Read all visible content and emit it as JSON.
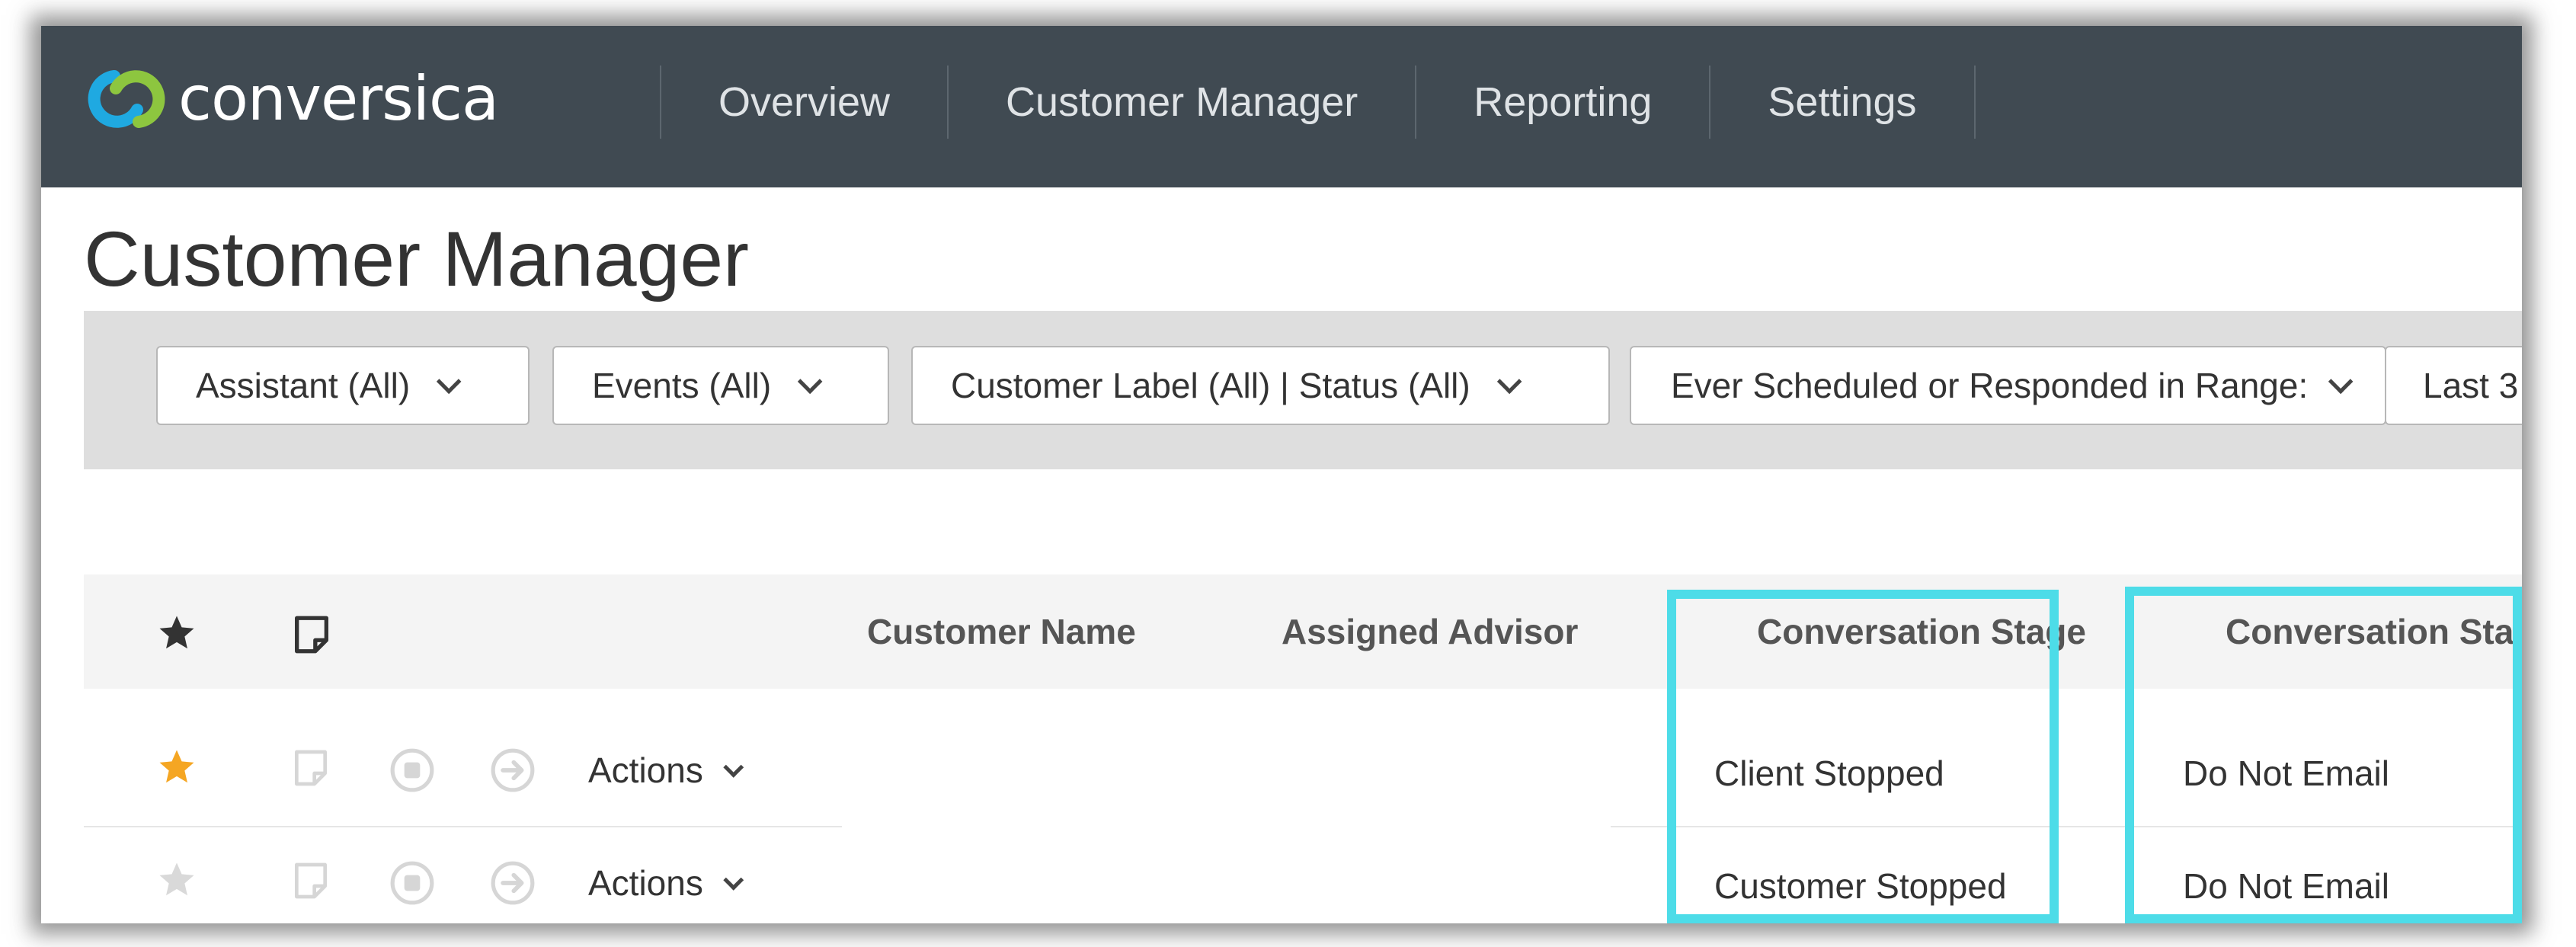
{
  "app": {
    "logo_text": "conversica"
  },
  "nav": {
    "items": [
      {
        "label": "Overview"
      },
      {
        "label": "Customer Manager"
      },
      {
        "label": "Reporting"
      },
      {
        "label": "Settings"
      }
    ]
  },
  "page": {
    "title": "Customer Manager"
  },
  "filters": [
    {
      "label": "Assistant (All)"
    },
    {
      "label": "Events (All)"
    },
    {
      "label": "Customer Label (All) | Status (All)"
    },
    {
      "label": "Ever Scheduled or Responded in Range:"
    },
    {
      "label": "Last 3"
    }
  ],
  "table": {
    "columns": {
      "customer_name": "Customer Name",
      "assigned_advisor": "Assigned Advisor",
      "conversation_stage": "Conversation Stage",
      "conversation_status": "Conversation Status"
    },
    "actions_label": "Actions",
    "rows": [
      {
        "starred": true,
        "conversation_stage": "Client Stopped",
        "conversation_status": "Do Not Email"
      },
      {
        "starred": false,
        "conversation_stage": "Customer Stopped",
        "conversation_status": "Do Not Email"
      }
    ]
  },
  "colors": {
    "topbar": "#404a52",
    "highlight": "#4ddce8",
    "star_active": "#f5a623",
    "star_inactive": "#d9d9d9"
  },
  "icons": [
    "conversica-logo-icon",
    "star-icon",
    "note-icon",
    "stop-icon",
    "forward-icon",
    "chevron-down-icon"
  ]
}
